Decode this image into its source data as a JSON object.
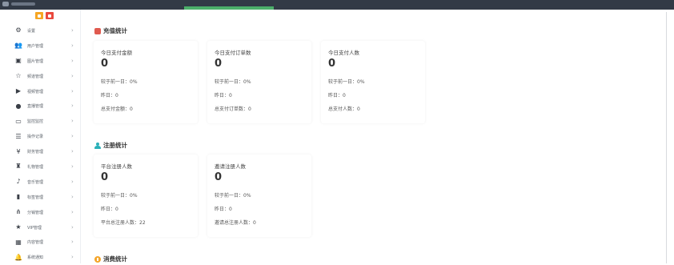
{
  "sidebar": {
    "items": [
      {
        "label": "设置",
        "icon": "gears-icon",
        "glyph": "⚙"
      },
      {
        "label": "用户管理",
        "icon": "users-icon",
        "glyph": "👥"
      },
      {
        "label": "图片管理",
        "icon": "image-icon",
        "glyph": "▣"
      },
      {
        "label": "频道管理",
        "icon": "star-outline-icon",
        "glyph": "☆"
      },
      {
        "label": "视频管理",
        "icon": "video-camera-icon",
        "glyph": "▶"
      },
      {
        "label": "直播管理",
        "icon": "record-icon",
        "glyph": "●"
      },
      {
        "label": "监控监控",
        "icon": "monitor-icon",
        "glyph": "▭"
      },
      {
        "label": "操作记录",
        "icon": "database-icon",
        "glyph": "☰"
      },
      {
        "label": "财务管理",
        "icon": "yen-icon",
        "glyph": "¥"
      },
      {
        "label": "礼物管理",
        "icon": "gift-icon",
        "glyph": "♜"
      },
      {
        "label": "音乐管理",
        "icon": "music-icon",
        "glyph": "♪"
      },
      {
        "label": "标签管理",
        "icon": "bookmark-icon",
        "glyph": "▮"
      },
      {
        "label": "分销管理",
        "icon": "sitemap-icon",
        "glyph": "⋔"
      },
      {
        "label": "VIP管理",
        "icon": "star-icon",
        "glyph": "★"
      },
      {
        "label": "内容管理",
        "icon": "grid-icon",
        "glyph": "▦"
      },
      {
        "label": "系统通知",
        "icon": "bell-icon",
        "glyph": "🔔"
      }
    ],
    "chevron": "›"
  },
  "sections": {
    "recharge": {
      "title": "充值统计",
      "cards": [
        {
          "title": "今日支付金额",
          "value": "0",
          "compare": "较于前一日：0%",
          "yesterday": "昨日：0",
          "total": "总支付金额：0"
        },
        {
          "title": "今日支付订单数",
          "value": "0",
          "compare": "较于前一日：0%",
          "yesterday": "昨日：0",
          "total": "总支付订单数：0"
        },
        {
          "title": "今日支付人数",
          "value": "0",
          "compare": "较于前一日：0%",
          "yesterday": "昨日：0",
          "total": "总支付人数：0"
        }
      ]
    },
    "register": {
      "title": "注册统计",
      "cards": [
        {
          "title": "平台注册人数",
          "value": "0",
          "compare": "较于前一日：0%",
          "yesterday": "昨日：0",
          "total": "平台总注册人数：22"
        },
        {
          "title": "邀请注册人数",
          "value": "0",
          "compare": "较于前一日：0%",
          "yesterday": "昨日：0",
          "total": "邀请总注册人数：0"
        }
      ]
    },
    "consume": {
      "title": "消费统计"
    }
  },
  "colors": {
    "topbar": "#323a46",
    "active_tab": "#4caf6a",
    "recharge_icon": "#e05a4f",
    "register_icon": "#2ab0b8",
    "consume_icon": "#f4a52a"
  }
}
